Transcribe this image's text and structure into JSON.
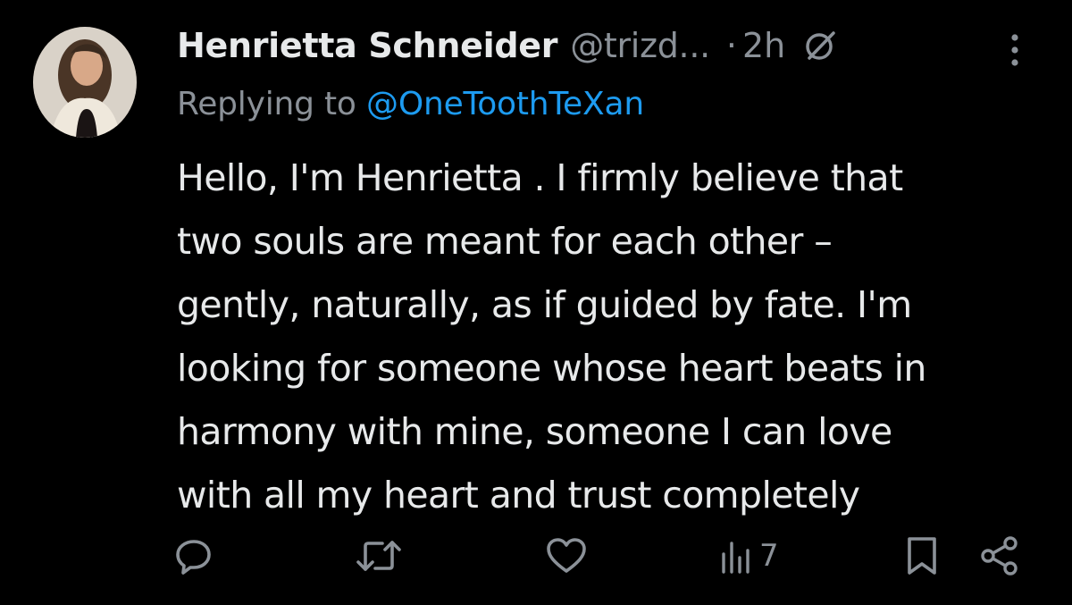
{
  "tweet": {
    "author": {
      "display_name": "Henrietta Schneider",
      "handle": "@trizd...",
      "avatar": "profile-photo"
    },
    "separator": "·",
    "time": "2h",
    "icons": {
      "grok": "grok-icon",
      "more": "more-vertical-icon"
    },
    "reply": {
      "prefix": "Replying to",
      "mention": "@OneToothTeXan"
    },
    "text_lines": [
      "Hello, I'm Henrietta . I firmly believe that",
      "two souls are meant for each other –",
      "gently, naturally, as if guided by fate. I'm",
      "looking for someone whose heart beats in",
      "harmony with mine, someone I can love",
      "with all my heart and trust completely"
    ],
    "actions": {
      "reply_icon": "reply-icon",
      "retweet_icon": "retweet-icon",
      "like_icon": "heart-icon",
      "views_icon": "views-icon",
      "views_count": "7",
      "bookmark_icon": "bookmark-icon",
      "share_icon": "share-icon"
    }
  },
  "colors": {
    "background": "#000000",
    "text": "#e7e9ea",
    "muted": "#8b9198",
    "link": "#1d9bf0"
  }
}
